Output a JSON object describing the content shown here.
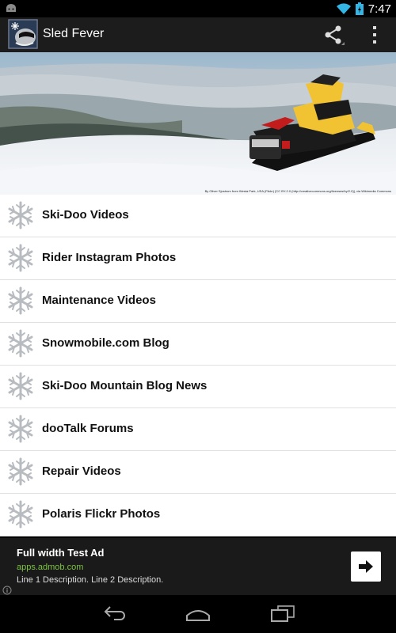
{
  "status": {
    "time": "7:47"
  },
  "app": {
    "title": "Sled Fever"
  },
  "hero": {
    "credit": "By Oliver Sjostrom from Westa Park, USA (Flickr) [CC BY-2.0 (http://creativecommons.org/licenses/by/2.0)], via Wikimedia Commons"
  },
  "menu": {
    "items": [
      {
        "label": "Ski-Doo Videos"
      },
      {
        "label": "Rider Instagram Photos"
      },
      {
        "label": "Maintenance Videos"
      },
      {
        "label": "Snowmobile.com Blog"
      },
      {
        "label": "Ski-Doo Mountain Blog News"
      },
      {
        "label": "dooTalk Forums"
      },
      {
        "label": "Repair Videos"
      },
      {
        "label": "Polaris Flickr Photos"
      }
    ]
  },
  "ad": {
    "title": "Full width Test Ad",
    "url": "apps.admob.com",
    "description": "Line 1 Description. Line 2 Description."
  }
}
